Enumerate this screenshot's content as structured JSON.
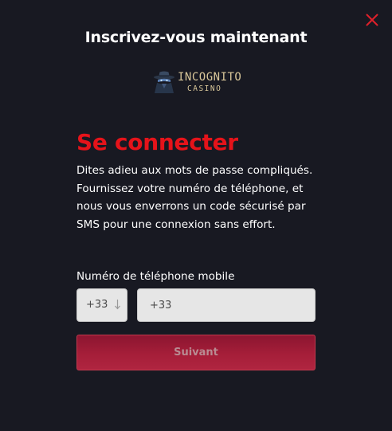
{
  "modal": {
    "title": "Inscrivez-vous maintenant",
    "close_icon": "close-icon"
  },
  "logo": {
    "text_main": "INCOGNITO",
    "text_sub": "CASINO",
    "icon": "spy-hat-icon",
    "color": "#d9c79a"
  },
  "login": {
    "heading": "Se connecter",
    "description": "Dites adieu aux mots de passe compliqués. Fournissez votre numéro de téléphone, et nous vous enverrons un code sécurisé par SMS pour une connexion sans effort.",
    "phone_label": "Numéro de téléphone mobile",
    "country_code": "+33",
    "phone_value": "+33",
    "submit_label": "Suivant"
  },
  "colors": {
    "background": "#181922",
    "accent_red": "#e5131a",
    "button_gradient_start": "#8c1530",
    "button_gradient_end": "#b02540",
    "input_background": "#e6e6e6"
  }
}
